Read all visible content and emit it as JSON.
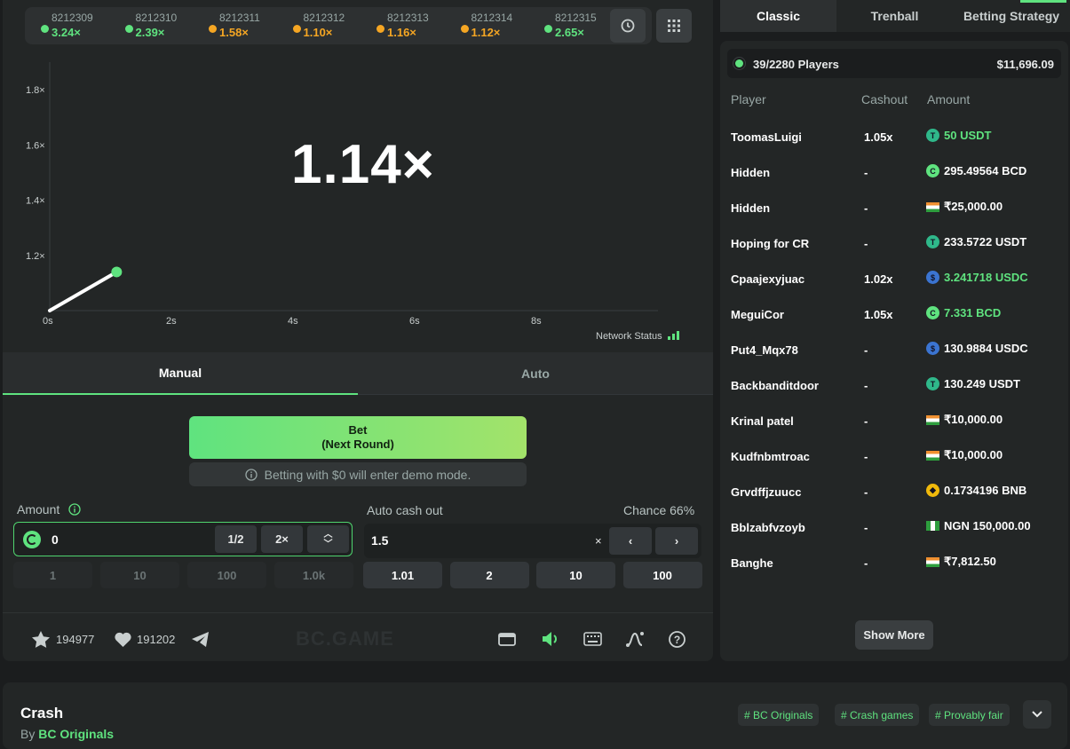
{
  "history": [
    {
      "id": "8212309",
      "value": "3.24×",
      "color": "#5fe37f"
    },
    {
      "id": "8212310",
      "value": "2.39×",
      "color": "#5fe37f"
    },
    {
      "id": "8212311",
      "value": "1.58×",
      "color": "#f5a623"
    },
    {
      "id": "8212312",
      "value": "1.10×",
      "color": "#f5a623"
    },
    {
      "id": "8212313",
      "value": "1.16×",
      "color": "#f5a623"
    },
    {
      "id": "8212314",
      "value": "1.12×",
      "color": "#f5a623"
    },
    {
      "id": "8212315",
      "value": "2.65×",
      "color": "#5fe37f"
    }
  ],
  "chart_data": {
    "type": "line",
    "x": [
      0,
      1.1
    ],
    "y": [
      1.0,
      1.14
    ],
    "xlim": [
      0,
      10
    ],
    "ylim": [
      1.0,
      1.9
    ],
    "x_ticks": [
      "0s",
      "2s",
      "4s",
      "6s",
      "8s"
    ],
    "y_ticks": [
      "1.2×",
      "1.4×",
      "1.6×",
      "1.8×"
    ],
    "grid": false
  },
  "current_multiplier": "1.14×",
  "network_status": "Network Status",
  "mode_tabs": {
    "manual": "Manual",
    "auto": "Auto"
  },
  "bet_button": {
    "line1": "Bet",
    "line2": "(Next Round)"
  },
  "demo_note": "Betting with $0 will enter demo mode.",
  "amount": {
    "label": "Amount",
    "value": "0",
    "half": "1/2",
    "double": "2×",
    "quick": [
      "1",
      "10",
      "100",
      "1.0k"
    ]
  },
  "cashout": {
    "label": "Auto cash out",
    "chance": "Chance 66%",
    "value": "1.5",
    "suffix": "×",
    "quick": [
      "1.01",
      "2",
      "10",
      "100"
    ]
  },
  "social": {
    "stars": "194977",
    "likes": "191202"
  },
  "brand": "BC.GAME",
  "right_tabs": [
    "Classic",
    "Trenball",
    "Betting Strategy"
  ],
  "players_header": {
    "count": "39/2280 Players",
    "total": "$11,696.09"
  },
  "columns": {
    "player": "Player",
    "cashout": "Cashout",
    "amount": "Amount"
  },
  "players": [
    {
      "name": "ToomasLuigi",
      "cashout": "1.05x",
      "amount": "50 USDT",
      "currency": "USDT",
      "won": true
    },
    {
      "name": "Hidden",
      "cashout": "-",
      "amount": "295.49564 BCD",
      "currency": "BCD",
      "won": false
    },
    {
      "name": "Hidden",
      "cashout": "-",
      "amount": "₹25,000.00",
      "currency": "INR",
      "won": false
    },
    {
      "name": "Hoping for CR",
      "cashout": "-",
      "amount": "233.5722 USDT",
      "currency": "USDT",
      "won": false
    },
    {
      "name": "Cpaajexyjuac",
      "cashout": "1.02x",
      "amount": "3.241718 USDC",
      "currency": "USDC",
      "won": true
    },
    {
      "name": "MeguiCor",
      "cashout": "1.05x",
      "amount": "7.331 BCD",
      "currency": "BCD",
      "won": true
    },
    {
      "name": "Put4_Mqx78",
      "cashout": "-",
      "amount": "130.9884 USDC",
      "currency": "USDC",
      "won": false
    },
    {
      "name": "Backbanditdoor",
      "cashout": "-",
      "amount": "130.249 USDT",
      "currency": "USDT",
      "won": false
    },
    {
      "name": "Krinal patel",
      "cashout": "-",
      "amount": "₹10,000.00",
      "currency": "INR",
      "won": false
    },
    {
      "name": "Kudfnbmtroac",
      "cashout": "-",
      "amount": "₹10,000.00",
      "currency": "INR",
      "won": false
    },
    {
      "name": "Grvdffjzuucc",
      "cashout": "-",
      "amount": "0.1734196 BNB",
      "currency": "BNB",
      "won": false
    },
    {
      "name": "Bblzabfvzoyb",
      "cashout": "-",
      "amount": "NGN 150,000.00",
      "currency": "NGN",
      "won": false
    },
    {
      "name": "Banghe",
      "cashout": "-",
      "amount": "₹7,812.50",
      "currency": "INR",
      "won": false
    }
  ],
  "show_more": "Show More",
  "footer": {
    "title": "Crash",
    "by": "By",
    "author": "BC Originals",
    "tags": [
      "# BC Originals",
      "# Crash games",
      "# Provably fair"
    ]
  }
}
